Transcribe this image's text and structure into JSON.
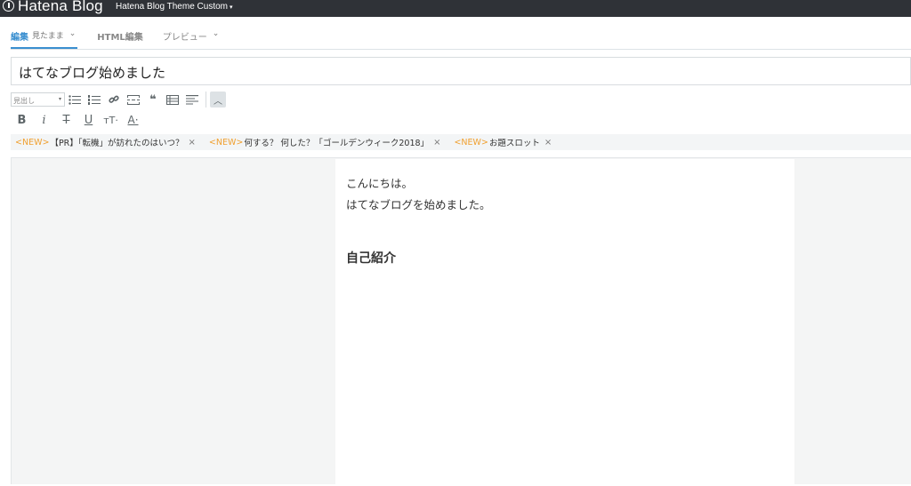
{
  "app": {
    "logo_text": "Hatena Blog",
    "blog_name": "Hatena Blog Theme Custom",
    "caret": "▾"
  },
  "tabs": [
    {
      "label": "編集",
      "sub": "見たまま",
      "chevron": "⌄"
    },
    {
      "label": "HTML編集"
    },
    {
      "label": "プレビュー",
      "chevron": "⌄"
    }
  ],
  "title_input": {
    "value": "はてなブログ始めました"
  },
  "toolbar1": {
    "heading_select": "見出し",
    "collapse_icon": "︿"
  },
  "toolbar2": {
    "bold": "B",
    "italic": "i",
    "strike": "T",
    "underline": "U",
    "size": "тT·",
    "color": "A·"
  },
  "topics": [
    {
      "tag": "<NEW>",
      "text": "【PR】「転機」が訪れたのはいつ？"
    },
    {
      "tag": "<NEW>",
      "text": "何する？ 何した？「ゴールデンウィーク2018」"
    },
    {
      "tag": "<NEW>",
      "text": "お題スロット"
    }
  ],
  "topic_close": "×",
  "content": {
    "line1": "こんにちは。",
    "line2": "はてなブログを始めました。",
    "heading": "自己紹介"
  },
  "colors": {
    "topbar_bg": "#2f3237",
    "accent": "#3a8fd0",
    "new_tag": "#f0a030"
  }
}
